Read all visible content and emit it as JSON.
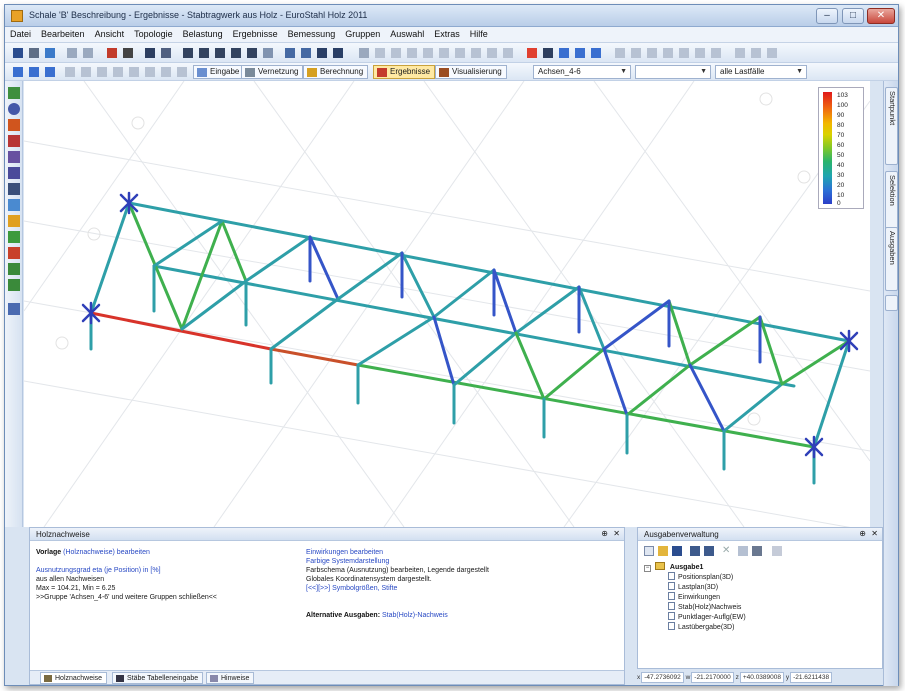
{
  "window": {
    "title": "Schale 'B' Beschreibung - Ergebnisse - Stabtragwerk aus Holz - EuroStahl Holz 2011",
    "controls": [
      "–",
      "□",
      "✕"
    ]
  },
  "menu": [
    "Datei",
    "Bearbeiten",
    "Ansicht",
    "Topologie",
    "Belastung",
    "Ergebnisse",
    "Bemessung",
    "Gruppen",
    "Auswahl",
    "Extras",
    "Hilfe"
  ],
  "phase_tabs": [
    "Eingabe",
    "Vernetzung",
    "Berechnung",
    "Ergebnisse",
    "Visualisierung"
  ],
  "selectors": {
    "group": "Achsen_4-6",
    "loadcase": "alle Lastfälle"
  },
  "legend": {
    "values": [
      "103",
      "100",
      "90",
      "80",
      "70",
      "60",
      "50",
      "40",
      "30",
      "20",
      "10",
      "0"
    ],
    "colors": [
      "#e0191b",
      "#f2b700",
      "#80c828",
      "#1fa6b0",
      "#2b3ec8"
    ]
  },
  "right_tabs": [
    "Startpunkt",
    "Selektion",
    "Ausgaben"
  ],
  "holz_panel": {
    "title": "Holznachweise",
    "vorlage_label": "Vorlage",
    "vorlage_link": "(Holznachweise) bearbeiten",
    "lines": [
      "Ausnutzungsgrad eta (je Position) in [%]",
      "aus allen Nachweisen",
      "Max = 104.21, Min = 6.25",
      ">>Gruppe 'Achsen_4-6' und weitere Gruppen schließen<<"
    ],
    "right_lines": [
      "Einwirkungen bearbeiten",
      "Farbige Systemdarstellung",
      "Farbschema (Ausnutzung) bearbeiten, Legende dargestellt",
      "Globales Koordinatensystem dargestellt.",
      "[<<][>>] Symbolgrößen, Stifte"
    ],
    "alt_label": "Alternative Ausgaben:",
    "alt_link": "Stab(Holz)-Nachweis",
    "tabs": [
      "Holznachweise",
      "Stäbe Tabelleneingabe",
      "Hinweise"
    ]
  },
  "output_panel": {
    "title": "Ausgabenverwaltung",
    "root": "Ausgabe1",
    "items": [
      "Positionsplan(3D)",
      "Lastplan(3D)",
      "Einwirkungen",
      "Stab(Holz)Nachweis",
      "Punktlager-Auflg(EW)",
      "Lastübergabe(3D)"
    ]
  },
  "status": {
    "x_label": "x",
    "x": "-47.2736092",
    "w_label": "w",
    "w": "-21.2170000",
    "z_label": "z",
    "z": "+40.0389008",
    "y_label": "y",
    "y": "-21.6211438"
  }
}
